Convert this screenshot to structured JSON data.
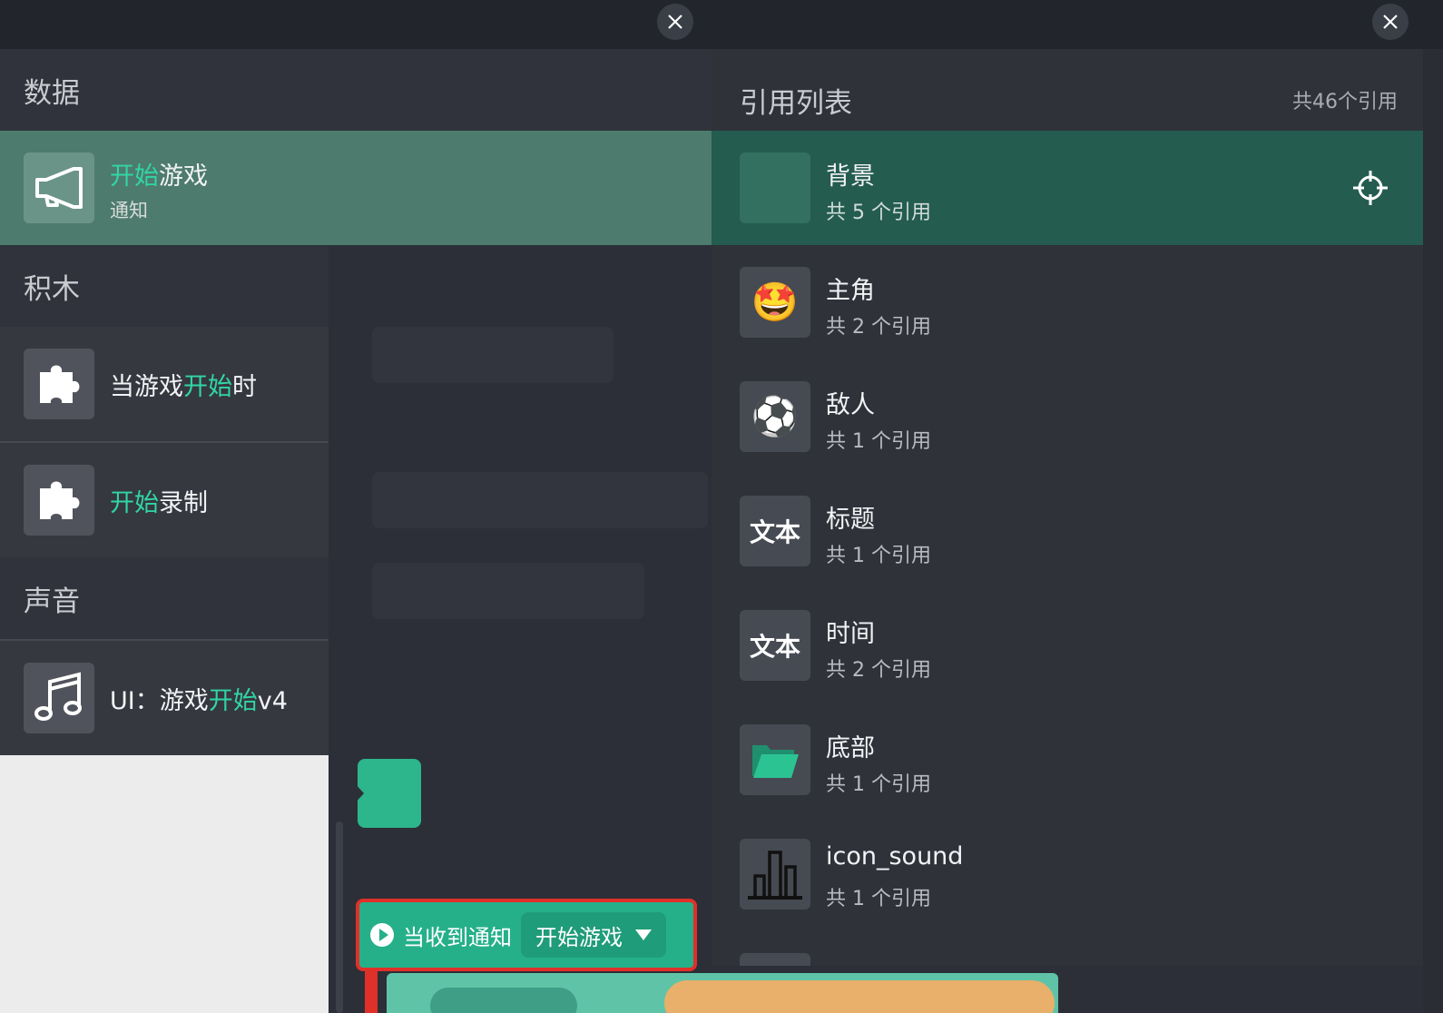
{
  "colors": {
    "accent": "#31d6a4",
    "selected_left": "#4d7b6d",
    "selected_right": "#245c4f",
    "event_block": "#25b08a",
    "highlight_border": "#e0302a"
  },
  "top_bar": {
    "left_close_icon": "close-icon",
    "right_close_icon": "close-icon"
  },
  "left_panel": {
    "sections": {
      "data": "数据",
      "blocks": "积木",
      "sound": "声音"
    },
    "data_item": {
      "icon": "megaphone-icon",
      "title_hl": "开始",
      "title_rest": "游戏",
      "subtitle": "通知"
    },
    "block_items": [
      {
        "icon": "puzzle-icon",
        "pre": "当游戏",
        "hl": "开始",
        "post": "时"
      },
      {
        "icon": "puzzle-icon",
        "pre": "",
        "hl": "开始",
        "post": "录制"
      }
    ],
    "sound_item": {
      "icon": "music-note-icon",
      "pre": "UI：游戏",
      "hl": "开始",
      "post": "v4"
    }
  },
  "workspace": {
    "event_block_label": "当收到通知",
    "event_block_value": "开始游戏"
  },
  "right_panel": {
    "title": "引用列表",
    "total": "共46个引用",
    "items": [
      {
        "name": "背景",
        "refs": "共 5 个引用",
        "icon": "blank-icon"
      },
      {
        "name": "主角",
        "refs": "共 2 个引用",
        "icon": "star-eyes-emoji-icon",
        "glyph": "🤩"
      },
      {
        "name": "敌人",
        "refs": "共 1 个引用",
        "icon": "soccer-ball-icon",
        "glyph": "⚽"
      },
      {
        "name": "标题",
        "refs": "共 1 个引用",
        "icon": "text-icon",
        "glyph": "文本"
      },
      {
        "name": "时间",
        "refs": "共 2 个引用",
        "icon": "text-icon",
        "glyph": "文本"
      },
      {
        "name": "底部",
        "refs": "共 1 个引用",
        "icon": "folder-icon"
      },
      {
        "name": "icon_sound",
        "refs": "共 1 个引用",
        "icon": "bar-chart-icon"
      }
    ],
    "locate_icon": "crosshair-icon"
  }
}
